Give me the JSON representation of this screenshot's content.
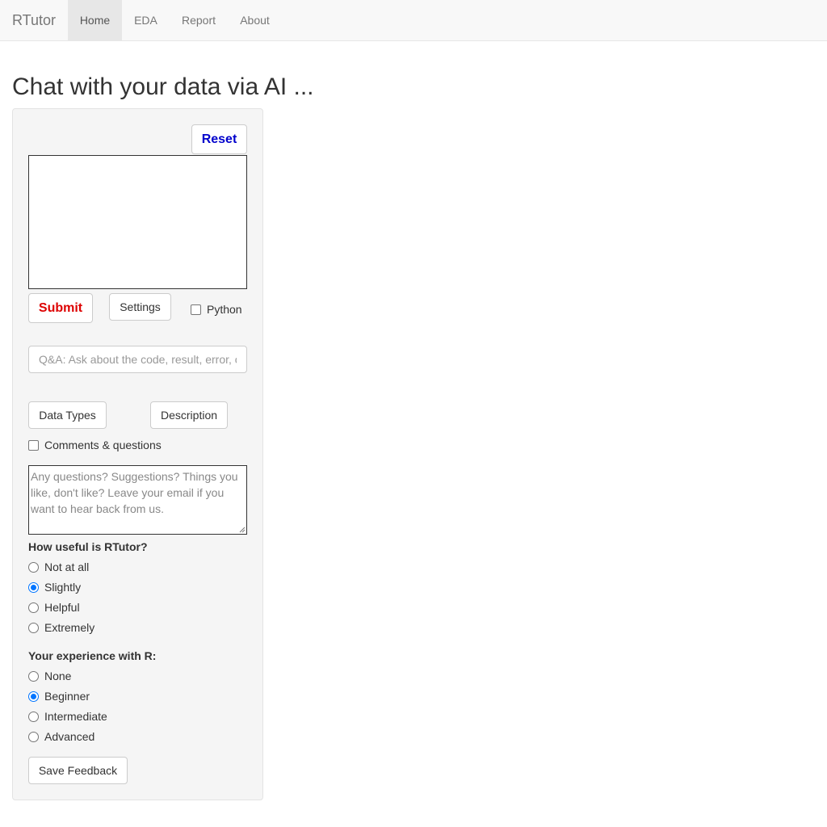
{
  "navbar": {
    "brand": "RTutor",
    "tabs": [
      {
        "label": "Home",
        "active": true
      },
      {
        "label": "EDA",
        "active": false
      },
      {
        "label": "Report",
        "active": false
      },
      {
        "label": "About",
        "active": false
      }
    ]
  },
  "page": {
    "title": "Chat with your data via AI ..."
  },
  "chat": {
    "reset_label": "Reset",
    "prompt_value": "",
    "submit_label": "Submit",
    "settings_label": "Settings",
    "python_label": "Python",
    "python_checked": false,
    "qa_placeholder": "Q&A: Ask about the code, result, error, or other questions."
  },
  "tools": {
    "data_types_label": "Data Types",
    "description_label": "Description"
  },
  "feedback": {
    "comments_label": "Comments & questions",
    "comments_checked": false,
    "comments_placeholder": "Any questions? Suggestions? Things you like, don't like? Leave your email if you want to hear back from us.",
    "usefulness": {
      "question": "How useful is RTutor?",
      "options": [
        "Not at all",
        "Slightly",
        "Helpful",
        "Extremely"
      ],
      "selected": "Slightly"
    },
    "experience": {
      "question": "Your experience with R:",
      "options": [
        "None",
        "Beginner",
        "Intermediate",
        "Advanced"
      ],
      "selected": "Beginner"
    },
    "save_label": "Save Feedback"
  },
  "colors": {
    "reset": "#0000cc",
    "submit": "#dd0000",
    "radio_accent": "#0075ff"
  }
}
